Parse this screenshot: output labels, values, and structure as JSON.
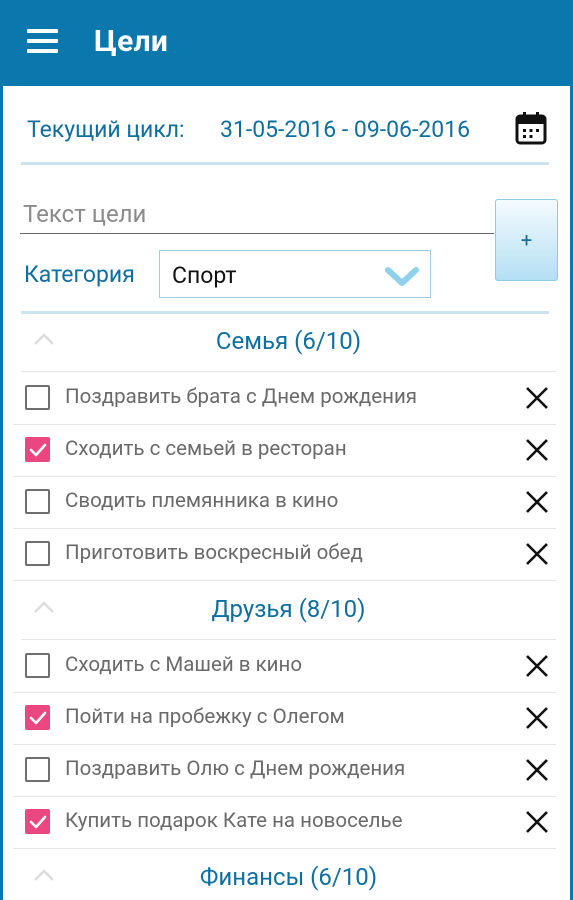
{
  "app_bar": {
    "title": "Цели"
  },
  "cycle": {
    "label": "Текущий цикл:",
    "range": "31-05-2016 - 09-06-2016"
  },
  "goal_input": {
    "placeholder": "Текст цели",
    "value": ""
  },
  "add_button": {
    "label": "+"
  },
  "category": {
    "label": "Категория",
    "selected": "Спорт"
  },
  "colors": {
    "primary": "#0b78ad",
    "accent_text": "#0f6fa0",
    "checkbox_checked": "#ec4681"
  },
  "sections": [
    {
      "title": "Семья (6/10)",
      "items": [
        {
          "text": "Поздравить брата с Днем рождения",
          "checked": false
        },
        {
          "text": "Сходить с семьей в ресторан",
          "checked": true
        },
        {
          "text": "Сводить племянника в кино",
          "checked": false
        },
        {
          "text": "Приготовить воскресный обед",
          "checked": false
        }
      ]
    },
    {
      "title": "Друзья (8/10)",
      "items": [
        {
          "text": "Сходить с Машей в кино",
          "checked": false
        },
        {
          "text": "Пойти на пробежку с Олегом",
          "checked": true
        },
        {
          "text": "Поздравить Олю с Днем рождения",
          "checked": false
        },
        {
          "text": "Купить подарок Кате на новоселье",
          "checked": true
        }
      ]
    },
    {
      "title": "Финансы (6/10)",
      "items": []
    }
  ]
}
